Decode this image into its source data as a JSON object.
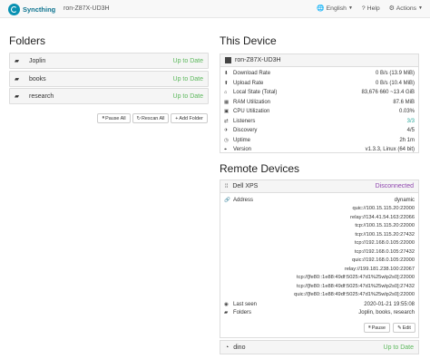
{
  "navbar": {
    "brand": "Syncthing",
    "device": "ron-Z87X-UD3H",
    "language": "English",
    "help": "Help",
    "actions": "Actions"
  },
  "folders": {
    "heading": "Folders",
    "items": [
      {
        "name": "Joplin",
        "status": "Up to Date",
        "icon": "folder-icon"
      },
      {
        "name": "books",
        "status": "Up to Date",
        "icon": "folder-icon"
      },
      {
        "name": "research",
        "status": "Up to Date",
        "icon": "folder-icon"
      }
    ],
    "pause_all": "Pause All",
    "rescan_all": "Rescan All",
    "add_folder": "Add Folder"
  },
  "this_device": {
    "heading": "This Device",
    "name": "ron-Z87X-UD3H",
    "stats": [
      {
        "label": "Download Rate",
        "value": "0 B/s (13.9 MiB)",
        "icon": "download-icon"
      },
      {
        "label": "Upload Rate",
        "value": "0 B/s (10.4 MiB)",
        "icon": "upload-icon"
      },
      {
        "label": "Local State (Total)",
        "value": "83,676   660   ~13.4 GiB",
        "icon": "home-icon"
      },
      {
        "label": "RAM Utilization",
        "value": "87.6 MiB",
        "icon": "ram-icon"
      },
      {
        "label": "CPU Utilization",
        "value": "0.03%",
        "icon": "cpu-icon"
      },
      {
        "label": "Listeners",
        "value": "3/3",
        "icon": "listeners-icon"
      },
      {
        "label": "Discovery",
        "value": "4/5",
        "icon": "discovery-icon"
      },
      {
        "label": "Uptime",
        "value": "2h 1m",
        "icon": "clock-icon"
      },
      {
        "label": "Version",
        "value": "v1.3.3, Linux (64 bit)",
        "icon": "tag-icon"
      }
    ]
  },
  "remote": {
    "heading": "Remote Devices",
    "device1": {
      "name": "Dell XPS",
      "status": "Disconnected",
      "address_label": "Address",
      "addresses": [
        "dynamic",
        "quic://100.15.115.20:22000",
        "relay://134.41.54.163:22066",
        "tcp://100.15.115.20:22000",
        "tcp://100.15.115.20:27432",
        "tcp://192.168.0.105:22000",
        "tcp://192.168.0.105:27432",
        "quic://192.168.0.105:22000",
        "relay://199.181.238.100:22067",
        "tcp://[fe80::1e88:49df:5025:47d1%25wlp2s0]:22000",
        "tcp://[fe80::1e88:49df:5025:47d1%25wlp2s0]:27432",
        "quic://[fe80::1e88:49df:5025:47d1%25wlp2s0]:22000"
      ],
      "last_seen_label": "Last seen",
      "last_seen": "2020-01-21 19:55:08",
      "folders_label": "Folders",
      "folders": "Joplin, books, research",
      "pause": "Pause",
      "edit": "Edit"
    },
    "device2": {
      "name": "dino",
      "status": "Up to Date"
    }
  },
  "colors": {
    "brand": "#0e7490",
    "ok": "#5cb85c",
    "teal": "#26a69a",
    "disconnected": "#8e44ad"
  }
}
